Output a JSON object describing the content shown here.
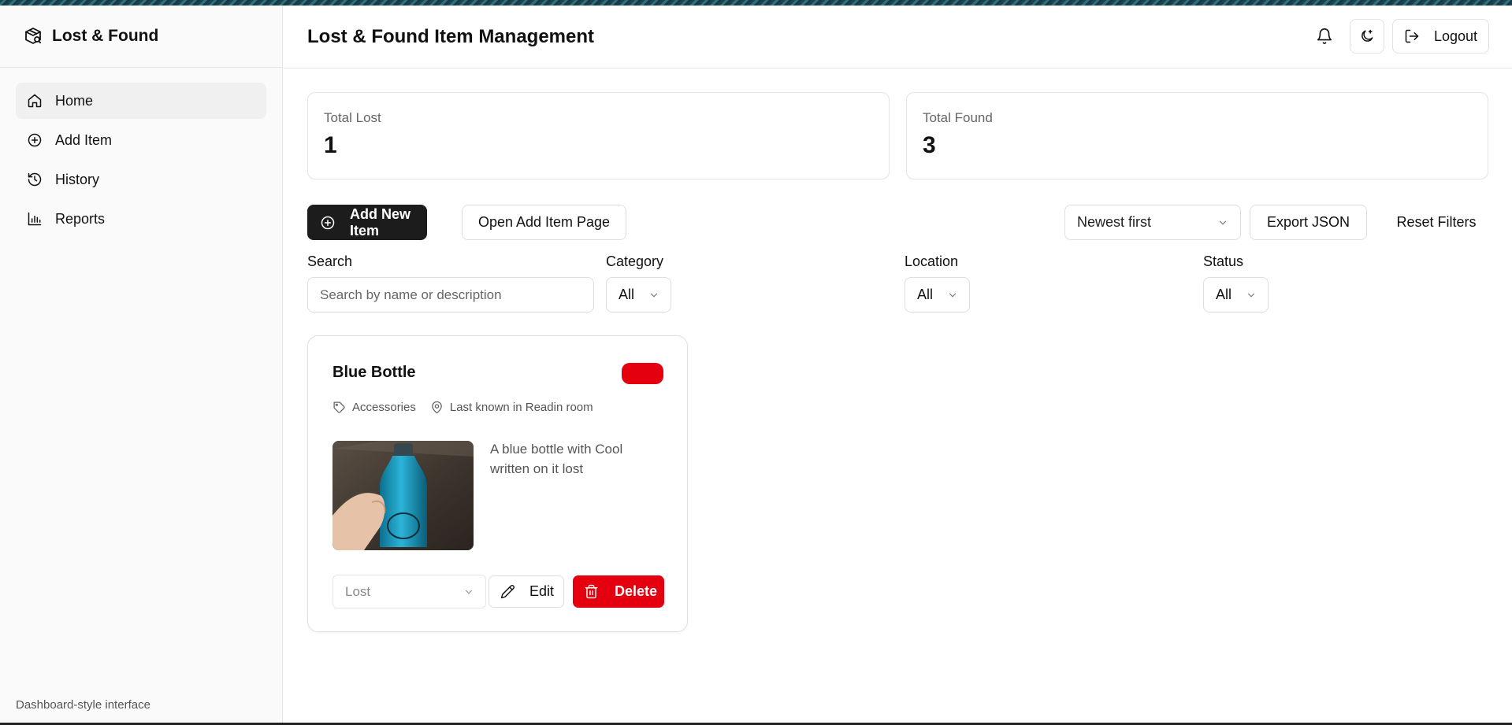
{
  "sidebar": {
    "brand": "Lost & Found",
    "items": [
      {
        "label": "Home",
        "icon": "home-icon",
        "active": true
      },
      {
        "label": "Add Item",
        "icon": "plus-circle-icon"
      },
      {
        "label": "History",
        "icon": "history-icon"
      },
      {
        "label": "Reports",
        "icon": "bar-chart-icon"
      }
    ],
    "footer": "Dashboard-style interface"
  },
  "header": {
    "title": "Lost & Found Item Management",
    "logout_label": "Logout"
  },
  "stats": {
    "total_lost_label": "Total Lost",
    "total_lost_value": "1",
    "total_found_label": "Total Found",
    "total_found_value": "3"
  },
  "toolbar": {
    "add_new_label": "Add New Item",
    "open_add_page_label": "Open Add Item Page",
    "sort_value": "Newest first",
    "export_label": "Export JSON",
    "reset_label": "Reset Filters"
  },
  "filters": {
    "search_label": "Search",
    "search_placeholder": "Search by name or description",
    "category_label": "Category",
    "category_value": "All",
    "location_label": "Location",
    "location_value": "All",
    "status_label": "Status",
    "status_value": "All"
  },
  "items": [
    {
      "title": "Blue Bottle",
      "status_color": "#e5000f",
      "category": "Accessories",
      "location": "Last known in Readin room",
      "description": "A blue bottle with Cool written on it lost",
      "status_select_value": "Lost",
      "edit_label": "Edit",
      "delete_label": "Delete"
    }
  ],
  "colors": {
    "primary_dark": "#1c1c1c",
    "danger": "#e5000f",
    "border": "#e3e3e3"
  }
}
